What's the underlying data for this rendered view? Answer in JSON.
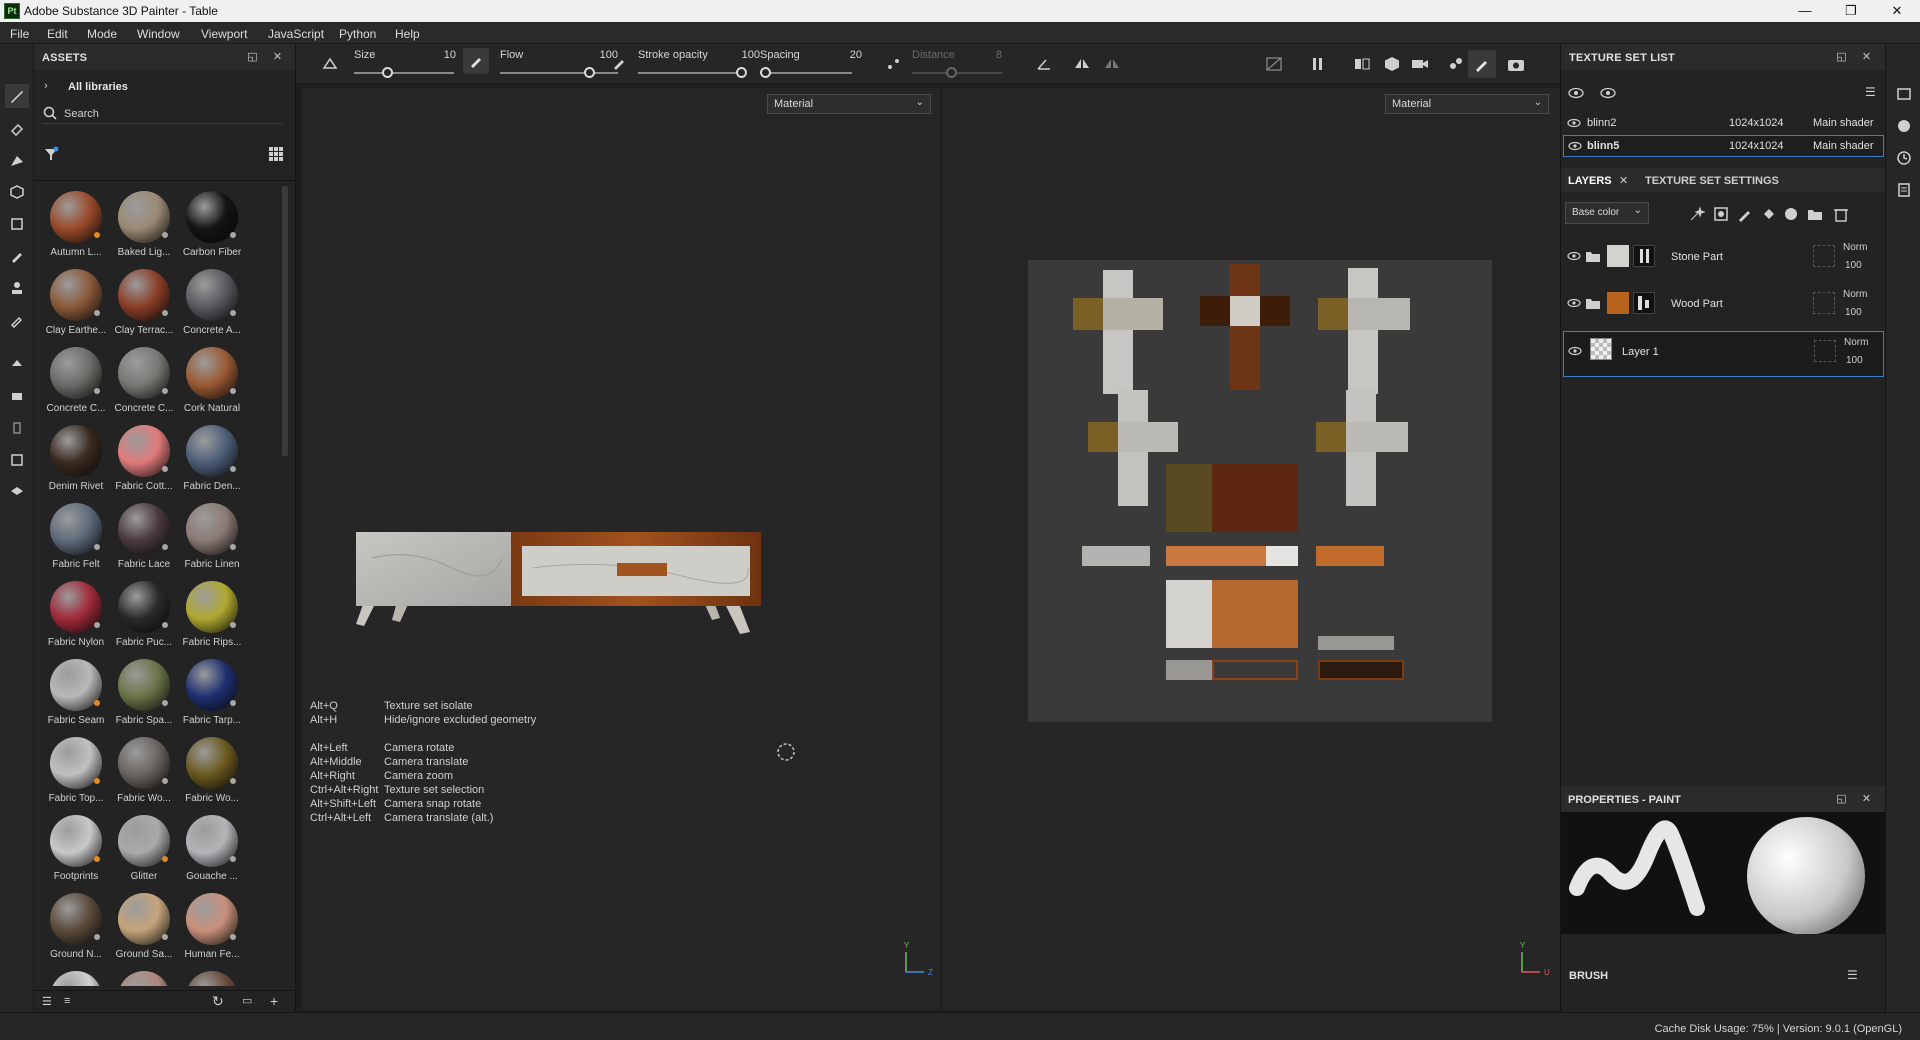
{
  "window": {
    "app_icon": "Pt",
    "title": "Adobe Substance 3D Painter - Table",
    "minimize": "—",
    "maximize": "❐",
    "close": "✕"
  },
  "menu": [
    "File",
    "Edit",
    "Mode",
    "Window",
    "Viewport",
    "JavaScript",
    "Python",
    "Help"
  ],
  "assets": {
    "title": "ASSETS",
    "breadcrumb": "All libraries",
    "search_placeholder": "Search",
    "materials": [
      {
        "label": "Autumn L...",
        "color": "#9a4a2a",
        "badge": "orange"
      },
      {
        "label": "Baked Lig...",
        "color": "#9a8a74",
        "badge": "white"
      },
      {
        "label": "Carbon Fiber",
        "color": "#141414",
        "badge": "white"
      },
      {
        "label": "Clay Earthe...",
        "color": "#8a5a3a",
        "badge": "white"
      },
      {
        "label": "Clay Terrac...",
        "color": "#8a3e28",
        "badge": "white"
      },
      {
        "label": "Concrete A...",
        "color": "#5a5a60",
        "badge": "white"
      },
      {
        "label": "Concrete C...",
        "color": "#6e6c68",
        "badge": "white"
      },
      {
        "label": "Concrete C...",
        "color": "#7a7874",
        "badge": "white"
      },
      {
        "label": "Cork Natural",
        "color": "#9a5a34",
        "badge": "white"
      },
      {
        "label": "Denim Rivet",
        "color": "#3a2a20",
        "badge": "none"
      },
      {
        "label": "Fabric Cott...",
        "color": "#e07a7a",
        "badge": "white"
      },
      {
        "label": "Fabric Den...",
        "color": "#4e5e7a",
        "badge": "white"
      },
      {
        "label": "Fabric Felt",
        "color": "#5e6a7a",
        "badge": "white"
      },
      {
        "label": "Fabric Lace",
        "color": "#4a3a3e",
        "badge": "white"
      },
      {
        "label": "Fabric Linen",
        "color": "#8a7a74",
        "badge": "white"
      },
      {
        "label": "Fabric Nylon",
        "color": "#a02a3a",
        "badge": "white"
      },
      {
        "label": "Fabric Puc...",
        "color": "#2a2a2a",
        "badge": "white"
      },
      {
        "label": "Fabric Rips...",
        "color": "#b0a830",
        "badge": "white"
      },
      {
        "label": "Fabric Seam",
        "color": "#b8b8b8",
        "badge": "orange"
      },
      {
        "label": "Fabric Spa...",
        "color": "#6a7448",
        "badge": "white"
      },
      {
        "label": "Fabric Tarp...",
        "color": "#1e3070",
        "badge": "white"
      },
      {
        "label": "Fabric Top...",
        "color": "#c0c0c0",
        "badge": "orange"
      },
      {
        "label": "Fabric Wo...",
        "color": "#6a6460",
        "badge": "white"
      },
      {
        "label": "Fabric Wo...",
        "color": "#6a5a20",
        "badge": "white"
      },
      {
        "label": "Footprints",
        "color": "#c8c8c8",
        "badge": "orange"
      },
      {
        "label": "Glitter",
        "color": "#aaaaaa",
        "badge": "orange"
      },
      {
        "label": "Gouache ...",
        "color": "#b4b4b8",
        "badge": "white"
      },
      {
        "label": "Ground N...",
        "color": "#5a4a3a",
        "badge": "white"
      },
      {
        "label": "Ground Sa...",
        "color": "#c4a47a",
        "badge": "white"
      },
      {
        "label": "Human Fe...",
        "color": "#c8907a",
        "badge": "white"
      },
      {
        "label": "",
        "color": "#d0d0d0",
        "badge": "none"
      },
      {
        "label": "",
        "color": "#b08880",
        "badge": "none"
      },
      {
        "label": "",
        "color": "#6a4a3a",
        "badge": "none"
      }
    ]
  },
  "toolbar": {
    "size_label": "Size",
    "size_value": "10",
    "flow_label": "Flow",
    "flow_value": "100",
    "stroke_label": "Stroke opacity",
    "stroke_value": "100",
    "spacing_label": "Spacing",
    "spacing_value": "20",
    "distance_label": "Distance",
    "distance_value": "8"
  },
  "viewport3d": {
    "mode": "Material",
    "hints": [
      {
        "key": "Alt+Q",
        "action": "Texture set isolate"
      },
      {
        "key": "Alt+H",
        "action": "Hide/ignore excluded geometry"
      },
      {
        "key": "Alt+Left",
        "action": "Camera rotate"
      },
      {
        "key": "Alt+Middle",
        "action": "Camera translate"
      },
      {
        "key": "Alt+Right",
        "action": "Camera zoom"
      },
      {
        "key": "Ctrl+Alt+Right",
        "action": "Texture set selection"
      },
      {
        "key": "Alt+Shift+Left",
        "action": "Camera snap rotate"
      },
      {
        "key": "Ctrl+Alt+Left",
        "action": "Camera translate (alt.)"
      }
    ],
    "axis_y": "Y",
    "axis_z": "Z"
  },
  "viewport2d": {
    "mode": "Material",
    "axis_y": "Y",
    "axis_u": "U"
  },
  "texture_set_list": {
    "title": "TEXTURE SET LIST",
    "rows": [
      {
        "name": "blinn2",
        "resolution": "1024x1024",
        "shader": "Main shader"
      },
      {
        "name": "blinn5",
        "resolution": "1024x1024",
        "shader": "Main shader"
      }
    ]
  },
  "layers": {
    "tab_layers": "LAYERS",
    "tab_settings": "TEXTURE SET SETTINGS",
    "channel": "Base color",
    "items": [
      {
        "name": "Stone Part",
        "blend": "Norm",
        "opacity": "100"
      },
      {
        "name": "Wood Part",
        "blend": "Norm",
        "opacity": "100"
      },
      {
        "name": "Layer 1",
        "blend": "Norm",
        "opacity": "100"
      }
    ]
  },
  "properties": {
    "title": "PROPERTIES - PAINT",
    "brush_label": "BRUSH"
  },
  "status": {
    "text": "Cache Disk Usage:   75% | Version: 9.0.1 (OpenGL)"
  }
}
